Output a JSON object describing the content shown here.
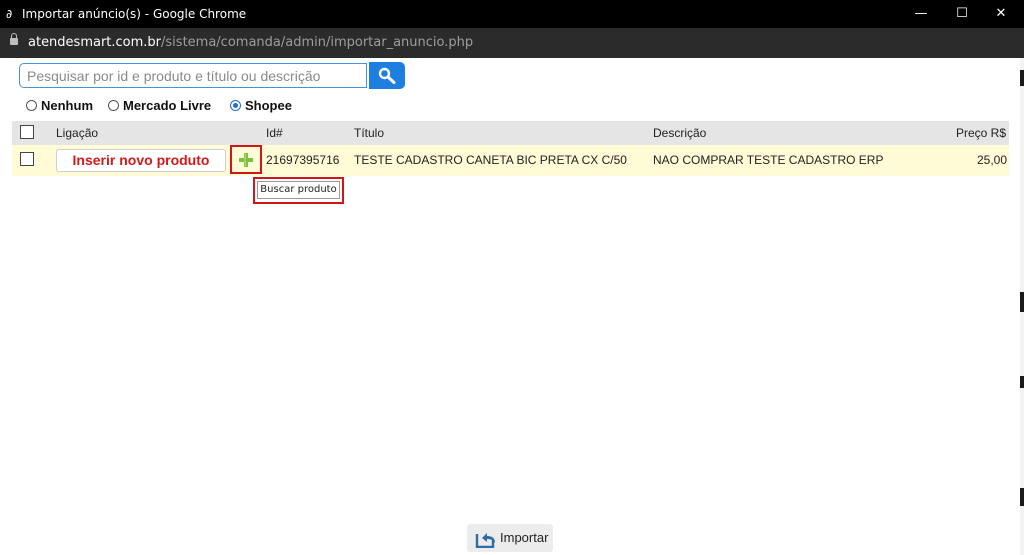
{
  "window": {
    "title": "Importar anúncio(s) - Google Chrome",
    "minimize": "—",
    "maximize": "☐",
    "close": "✕"
  },
  "address": {
    "host": "atendesmart.com.br",
    "path": "/sistema/comanda/admin/importar_anuncio.php"
  },
  "search": {
    "placeholder": "Pesquisar por id e produto e título ou descrição",
    "value": ""
  },
  "filters": {
    "options": [
      "Nenhum",
      "Mercado Livre",
      "Shopee"
    ],
    "selected": "Shopee"
  },
  "table": {
    "columns": {
      "link": "Ligação",
      "id": "Id#",
      "title": "Título",
      "description": "Descrição",
      "price": "Preço R$"
    },
    "rows": [
      {
        "action_label": "Inserir novo produto",
        "id": "21697395716",
        "title": "TESTE CADASTRO CANETA BIC PRETA CX C/50",
        "description": "NAO COMPRAR TESTE CADASTRO ERP",
        "price": "25,00"
      }
    ]
  },
  "tooltip": "Buscar produto",
  "footer": {
    "import_label": "Importar"
  },
  "colors": {
    "accent": "#1f7fe0",
    "highlight": "#d01616",
    "row_bg": "#fffbd6",
    "action_text": "#d11a1a"
  }
}
